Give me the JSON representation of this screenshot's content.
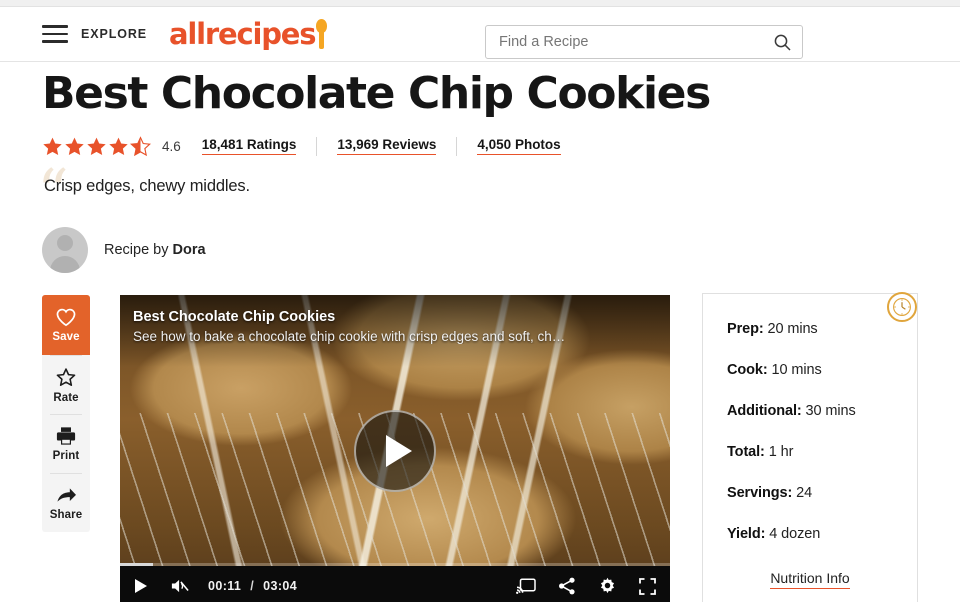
{
  "header": {
    "menu_icon": "hamburger-icon",
    "explore_label": "EXPLORE",
    "brand_name": "allrecipes",
    "brand_color": "#e8522a",
    "spoon_color": "#f5a623",
    "search": {
      "placeholder": "Find a Recipe",
      "value": "",
      "icon": "search-icon"
    }
  },
  "recipe": {
    "title": "Best Chocolate Chip Cookies",
    "rating": {
      "value": "4.6",
      "stars_full": 4,
      "stars_half": 1,
      "stars_total": 5,
      "star_color": "#e8522a"
    },
    "links": [
      {
        "label": "18,481 Ratings",
        "name": "ratings-link"
      },
      {
        "label": "13,969 Reviews",
        "name": "reviews-link"
      },
      {
        "label": "4,050 Photos",
        "name": "photos-link"
      }
    ],
    "quote": "Crisp edges, chewy middles.",
    "quote_mark": "“",
    "author_prefix": "Recipe by ",
    "author_name": "Dora"
  },
  "actions": [
    {
      "label": "Save",
      "icon": "heart-icon",
      "active": true
    },
    {
      "label": "Rate",
      "icon": "star-icon",
      "active": false
    },
    {
      "label": "Print",
      "icon": "printer-icon",
      "active": false
    },
    {
      "label": "Share",
      "icon": "share-arrow-icon",
      "active": false
    }
  ],
  "video": {
    "title": "Best Chocolate Chip Cookies",
    "description": "See how to bake a chocolate chip cookie with crisp edges and soft, ch…",
    "play_icon": "play-icon",
    "current_time": "00:11",
    "time_separator": "/",
    "duration": "03:04",
    "muted": true,
    "controls": [
      {
        "name": "play-button",
        "icon": "play-icon"
      },
      {
        "name": "mute-button",
        "icon": "volume-muted-icon"
      },
      {
        "name": "cast-button",
        "icon": "cast-icon"
      },
      {
        "name": "share-button",
        "icon": "share-icon"
      },
      {
        "name": "settings-button",
        "icon": "gear-icon"
      },
      {
        "name": "fullscreen-button",
        "icon": "fullscreen-icon"
      }
    ]
  },
  "info_card": {
    "clock_icon": "clock-icon",
    "clock_color": "#e0a53c",
    "rows": [
      {
        "label": "Prep:",
        "value": " 20 mins"
      },
      {
        "label": "Cook:",
        "value": " 10 mins"
      },
      {
        "label": "Additional:",
        "value": " 30 mins"
      },
      {
        "label": "Total:",
        "value": " 1 hr"
      },
      {
        "label": "Servings:",
        "value": " 24"
      },
      {
        "label": "Yield:",
        "value": " 4 dozen"
      }
    ],
    "nutrition_label": "Nutrition Info"
  }
}
